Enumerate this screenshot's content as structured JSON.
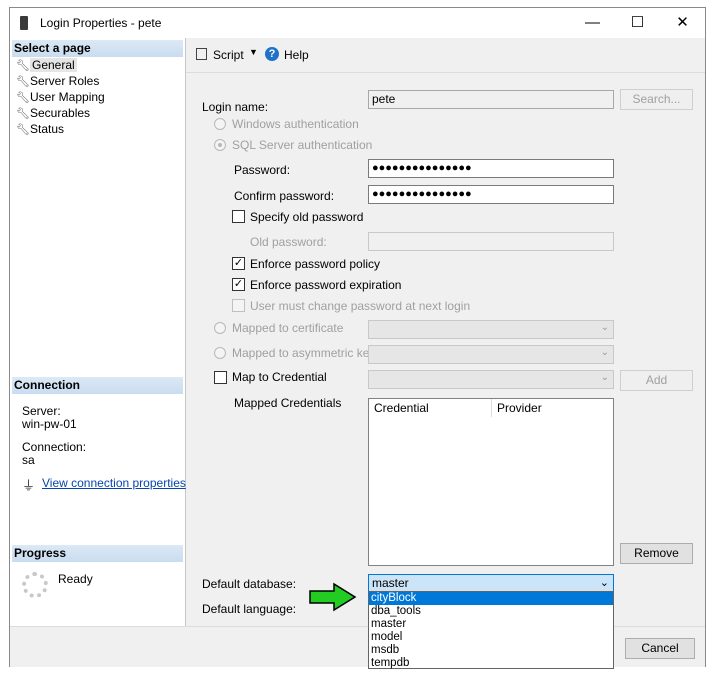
{
  "window": {
    "title": "Login Properties - pete",
    "minimize": "—",
    "maximize": "☐",
    "close": "✕"
  },
  "left": {
    "select_page_header": "Select a page",
    "pages": [
      {
        "label": "General",
        "icon": "wrench-icon"
      },
      {
        "label": "Server Roles",
        "icon": "wrench-icon"
      },
      {
        "label": "User Mapping",
        "icon": "wrench-icon"
      },
      {
        "label": "Securables",
        "icon": "wrench-icon"
      },
      {
        "label": "Status",
        "icon": "wrench-icon"
      }
    ],
    "connection_header": "Connection",
    "server_label": "Server:",
    "server_value": "win-pw-01",
    "connection_label": "Connection:",
    "connection_value": "sa",
    "view_props_link": "View connection properties",
    "progress_header": "Progress",
    "progress_status": "Ready"
  },
  "toolbar": {
    "script_label": "Script",
    "help_label": "Help"
  },
  "form": {
    "login_name_label": "Login name:",
    "login_name_value": "pete",
    "search_button": "Search...",
    "windows_auth": "Windows authentication",
    "sql_auth": "SQL Server authentication",
    "password_label": "Password:",
    "password_value": "●●●●●●●●●●●●●●●",
    "confirm_label": "Confirm password:",
    "confirm_value": "●●●●●●●●●●●●●●●",
    "specify_old": "Specify old password",
    "old_password_label": "Old password:",
    "enforce_policy": "Enforce password policy",
    "enforce_expiration": "Enforce password expiration",
    "must_change": "User must change password at next login",
    "mapped_cert": "Mapped to certificate",
    "mapped_asym": "Mapped to asymmetric key",
    "map_credential": "Map to Credential",
    "add_button": "Add",
    "mapped_credentials_label": "Mapped Credentials",
    "grid_columns": [
      "Credential",
      "Provider"
    ],
    "remove_button": "Remove",
    "default_db_label": "Default database:",
    "default_db_value": "master",
    "default_lang_label": "Default language:",
    "db_options": [
      "cityBlock",
      "dba_tools",
      "master",
      "model",
      "msdb",
      "tempdb"
    ],
    "db_highlighted": "cityBlock"
  },
  "footer": {
    "cancel_button": "Cancel"
  },
  "colors": {
    "accent": "#0078d7",
    "arrow": "#22cc22",
    "header_bg": "#c9dcef"
  }
}
